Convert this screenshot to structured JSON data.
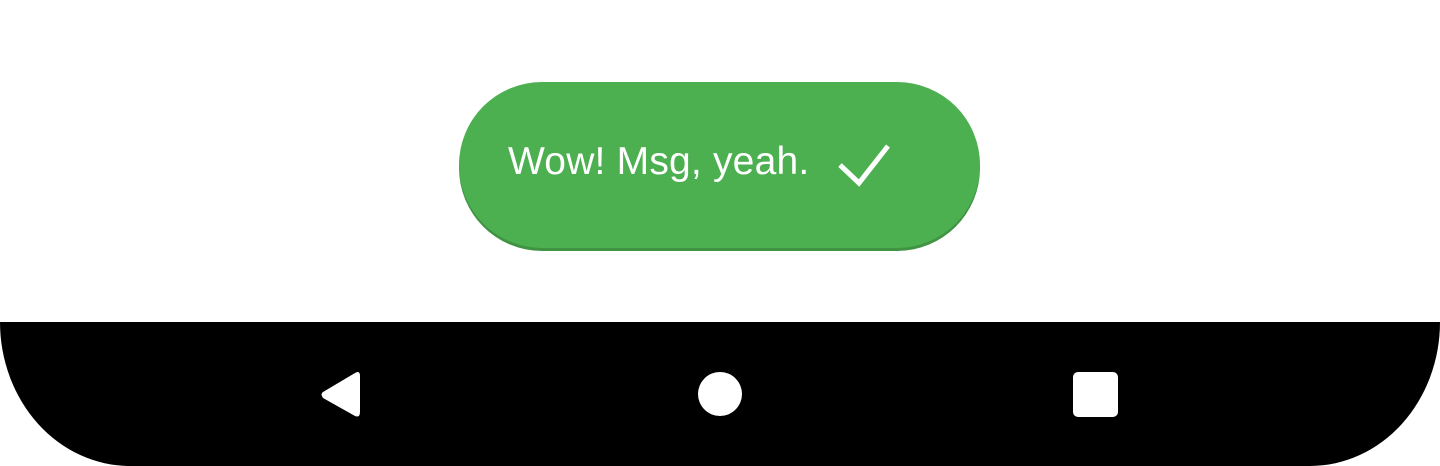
{
  "toast": {
    "message": "Wow! Msg, yeah.",
    "icon": "checkmark-icon",
    "background_color": "#4caf50",
    "text_color": "#ffffff"
  },
  "navigation_bar": {
    "background_color": "#000000",
    "buttons": [
      {
        "icon": "back-icon"
      },
      {
        "icon": "home-icon"
      },
      {
        "icon": "recents-icon"
      }
    ]
  }
}
